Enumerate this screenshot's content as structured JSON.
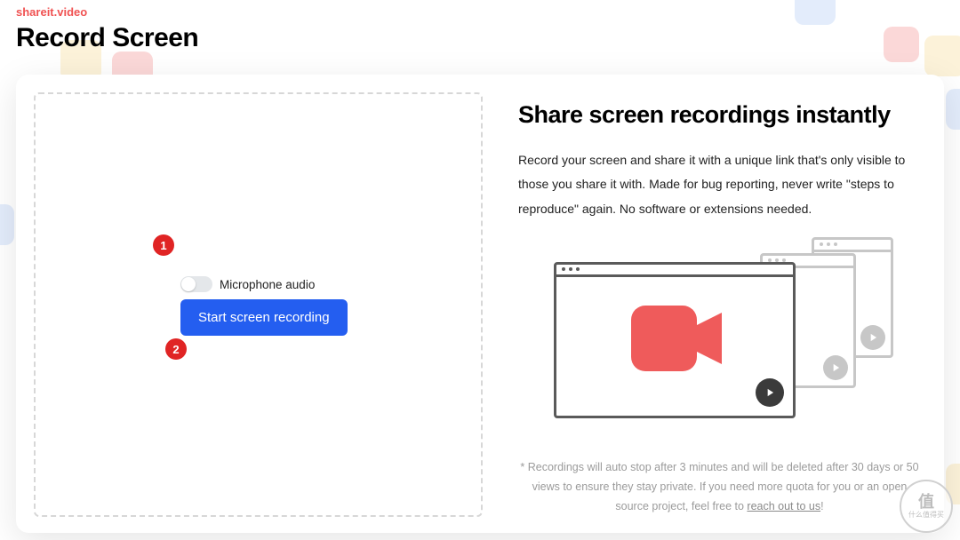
{
  "brand": "shareit.video",
  "page_title": "Record Screen",
  "markers": {
    "one": "1",
    "two": "2"
  },
  "mic": {
    "label": "Microphone audio"
  },
  "start_button": "Start screen recording",
  "right": {
    "title": "Share screen recordings instantly",
    "desc": "Record your screen and share it with a unique link that's only visible to those you share it with. Made for bug reporting, never write \"steps to reproduce\" again. No software or extensions needed.",
    "footnote_pre": "* Recordings will auto stop after 3 minutes and will be deleted after 30 days or 50 views to ensure they stay private. If you need more quota for you or an open source project, feel free to ",
    "footnote_link": "reach out to us",
    "footnote_post": "!"
  },
  "watermark": {
    "big": "值",
    "line1": "什么值得买",
    "line2": "."
  },
  "colors": {
    "accent": "#245ef0",
    "brand": "#f05252"
  }
}
